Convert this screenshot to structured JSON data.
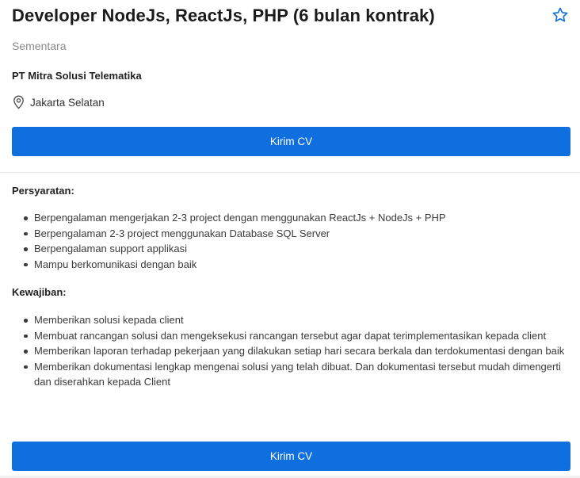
{
  "job": {
    "title": "Developer NodeJs, ReactJs, PHP (6 bulan kontrak)",
    "type": "Sementara",
    "company": "PT Mitra Solusi Telematika",
    "location": "Jakarta Selatan"
  },
  "actions": {
    "favorite_icon": "star-outline-icon",
    "apply_label_top": "Kirim CV",
    "apply_label_bottom": "Kirim CV"
  },
  "requirements": {
    "heading": "Persyaratan:",
    "items": [
      "Berpengalaman mengerjakan 2-3 project dengan menggunakan ReactJs + NodeJs + PHP",
      "Berpengalaman 2-3 project menggunakan Database SQL Server",
      "Berpengalaman support applikasi",
      "Mampu berkomunikasi dengan baik"
    ]
  },
  "duties": {
    "heading": "Kewajiban:",
    "items": [
      "Memberikan solusi kepada client",
      "Membuat rancangan solusi dan mengeksekusi rancangan tersebut agar dapat terimplementasikan kepada client",
      "Memberikan laporan terhadap pekerjaan yang dilakukan setiap hari secara berkala dan terdokumentasi dengan baik",
      "Memberikan dokumentasi lengkap mengenai solusi yang telah dibuat. Dan dokumentasi tersebut mudah dimengerti dan diserahkan kepada Client"
    ]
  },
  "colors": {
    "accent": "#0f6fde",
    "muted_text": "#8a8a8a",
    "body_text": "#3a3a3a"
  }
}
